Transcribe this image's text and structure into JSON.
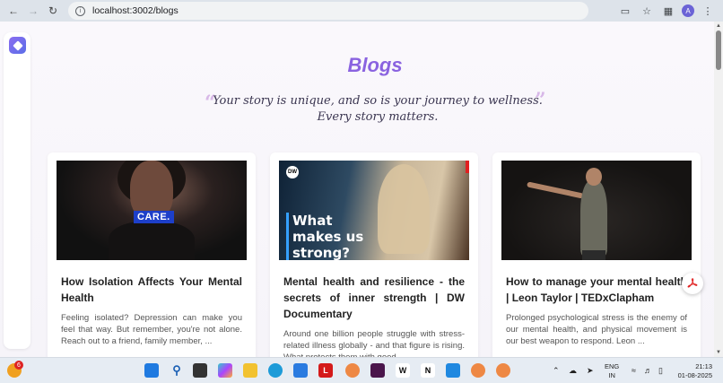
{
  "browser": {
    "url": "localhost:3002/blogs",
    "profile_initial": "A"
  },
  "page": {
    "title": "Blogs",
    "quote_line1": "Your story is unique, and so is your journey to wellness.",
    "quote_line2": "Every story matters.",
    "quote_open": "“",
    "quote_close": "”"
  },
  "blogs": [
    {
      "title": "How Isolation Affects Your Mental Health",
      "description": "Feeling isolated? Depression can make you feel that way. But remember, you're not alone. Reach out to a friend, family member, ...",
      "thumbnail_text": "CARE."
    },
    {
      "title": "Mental health and resilience - the secrets of inner strength | DW Documentary",
      "description": "Around one billion people struggle with stress-related illness globally - and that figure is rising. What protects them with good ...",
      "thumbnail_text": "What makes us strong?",
      "thumbnail_logo": "DW"
    },
    {
      "title": "How to manage your mental health | Leon Taylor | TEDxClapham",
      "description": "Prolonged psychological stress is the enemy of our mental health, and physical movement is our best weapon to respond. Leon ..."
    }
  ],
  "taskbar": {
    "weather_badge": "6",
    "lang_line1": "ENG",
    "lang_line2": "IN",
    "time": "21:13",
    "date": "01-08-2025"
  },
  "colors": {
    "accent": "#8a63e0",
    "quote_mark": "#d8b8e8",
    "pdf_red": "#e02020"
  }
}
